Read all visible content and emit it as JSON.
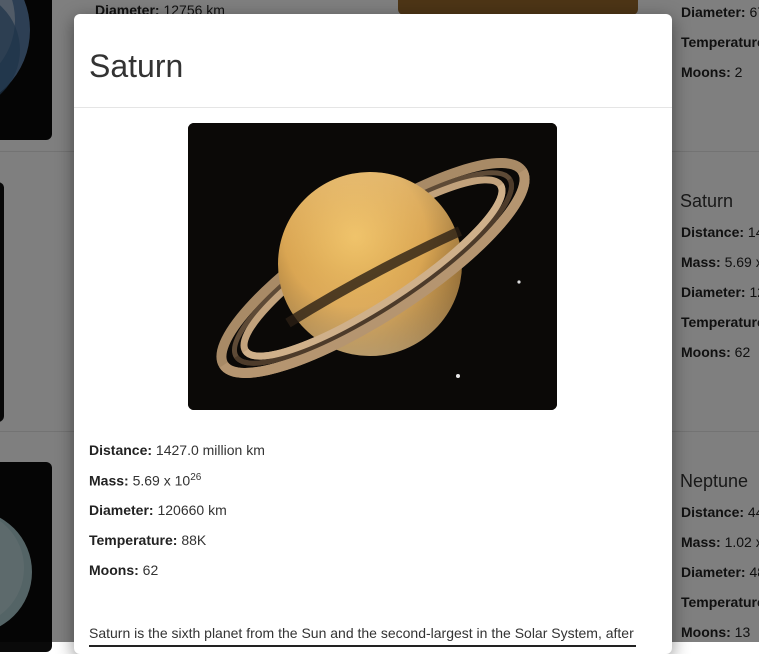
{
  "background": {
    "top_card": {
      "left_text": {
        "label": "Diameter:",
        "value": "12756 km"
      },
      "right_facts": [
        {
          "label": "Diameter:",
          "value": "67"
        },
        {
          "label": "Temperature",
          "value": ""
        },
        {
          "label": "Moons:",
          "value": "2"
        }
      ]
    },
    "saturn_card": {
      "title": "Saturn",
      "facts": [
        {
          "label": "Distance:",
          "value": "14"
        },
        {
          "label": "Mass:",
          "value": "5.69 x"
        },
        {
          "label": "Diameter:",
          "value": "12"
        },
        {
          "label": "Temperature",
          "value": ""
        },
        {
          "label": "Moons:",
          "value": "62"
        }
      ]
    },
    "neptune_card": {
      "title": "Neptune",
      "facts": [
        {
          "label": "Distance:",
          "value": "44"
        },
        {
          "label": "Mass:",
          "value": "1.02 x"
        },
        {
          "label": "Diameter:",
          "value": "48"
        },
        {
          "label": "Temperature",
          "value": ""
        },
        {
          "label": "Moons:",
          "value": "13"
        }
      ]
    }
  },
  "modal": {
    "title": "Saturn",
    "image_icon": "saturn-photo",
    "facts": {
      "distance": {
        "label": "Distance:",
        "value": "1427.0 million km"
      },
      "mass": {
        "label": "Mass:",
        "value": "5.69 x 10",
        "exponent": "26"
      },
      "diameter": {
        "label": "Diameter:",
        "value": "120660 km"
      },
      "temperature": {
        "label": "Temperature:",
        "value": "88K"
      },
      "moons": {
        "label": "Moons:",
        "value": "62"
      }
    },
    "description": "Saturn is the sixth planet from the Sun and the second-largest in the Solar System, after"
  },
  "colors": {
    "backdrop": "#000000",
    "modal_bg": "#ffffff",
    "text": "#333333"
  }
}
